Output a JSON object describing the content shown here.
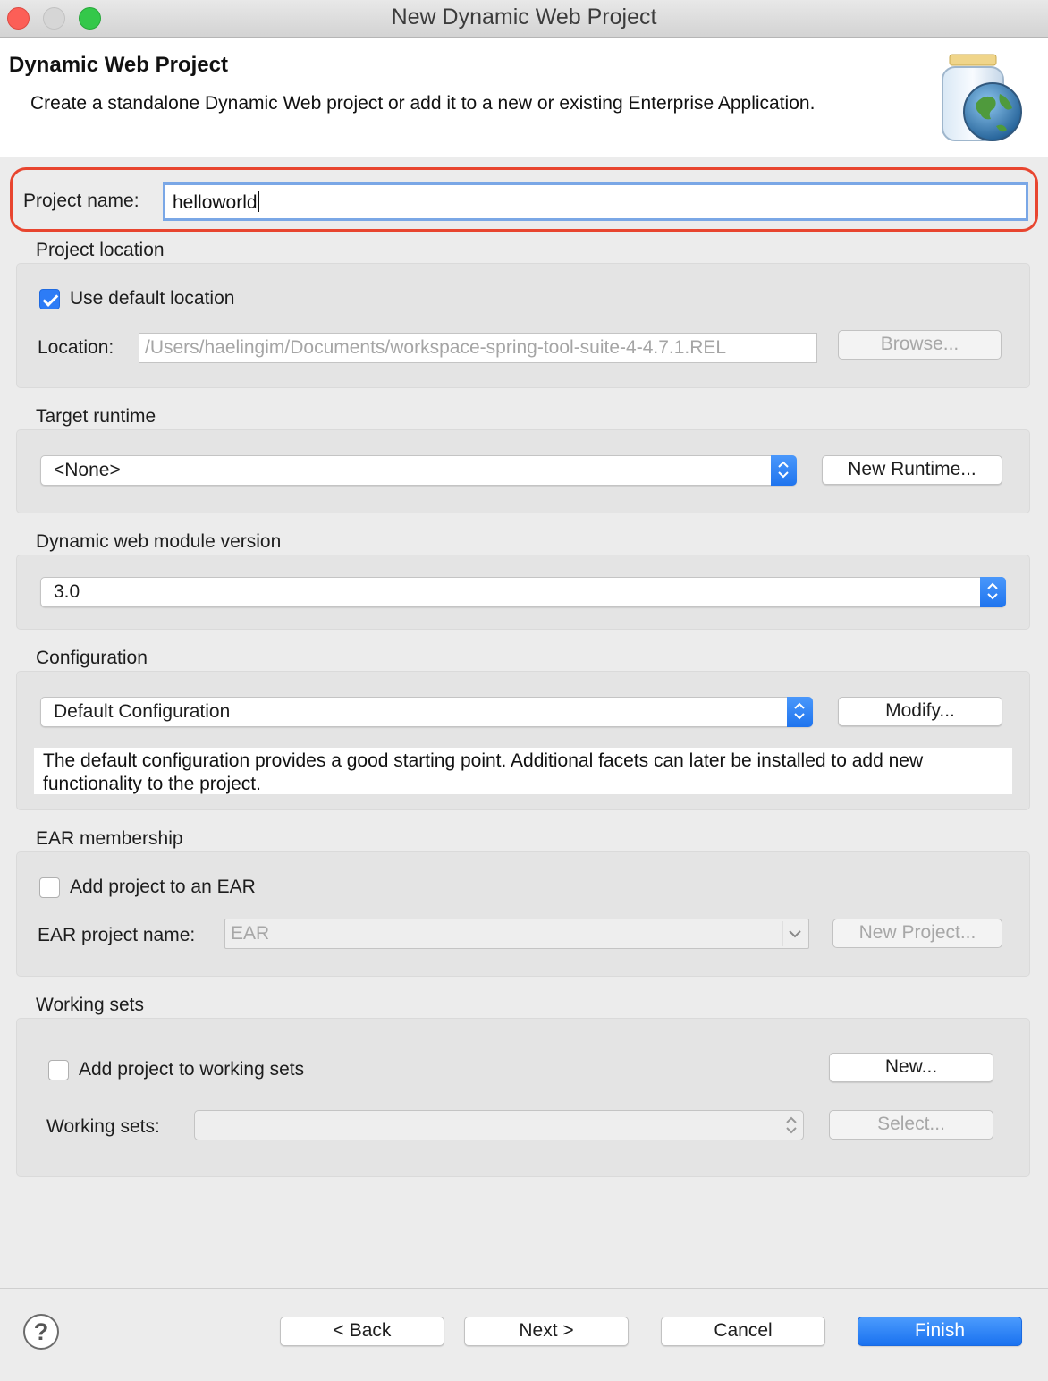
{
  "window": {
    "title": "New Dynamic Web Project"
  },
  "header": {
    "title": "Dynamic Web Project",
    "description": "Create a standalone Dynamic Web project or add it to a new or existing Enterprise Application."
  },
  "project_name": {
    "label": "Project name:",
    "value": "helloworld"
  },
  "project_location": {
    "group_label": "Project location",
    "use_default_label": "Use default location",
    "use_default_checked": true,
    "location_label": "Location:",
    "location_value": "/Users/haelingim/Documents/workspace-spring-tool-suite-4-4.7.1.REL",
    "browse_label": "Browse..."
  },
  "target_runtime": {
    "group_label": "Target runtime",
    "selected": "<None>",
    "new_runtime_label": "New Runtime..."
  },
  "module_version": {
    "group_label": "Dynamic web module version",
    "selected": "3.0"
  },
  "configuration": {
    "group_label": "Configuration",
    "selected": "Default Configuration",
    "modify_label": "Modify...",
    "description": "The default configuration provides a good starting point. Additional facets can later be installed to add new functionality to the project."
  },
  "ear_membership": {
    "group_label": "EAR membership",
    "add_label": "Add project to an EAR",
    "add_checked": false,
    "name_label": "EAR project name:",
    "name_value": "EAR",
    "new_project_label": "New Project..."
  },
  "working_sets": {
    "group_label": "Working sets",
    "add_label": "Add project to working sets",
    "add_checked": false,
    "new_label": "New...",
    "sets_label": "Working sets:",
    "select_label": "Select..."
  },
  "footer": {
    "help_symbol": "?",
    "back_label": "< Back",
    "next_label": "Next >",
    "cancel_label": "Cancel",
    "finish_label": "Finish"
  },
  "colors": {
    "accent": "#2d7cf6",
    "highlight": "#e8452f",
    "finish": "#1a72f0"
  },
  "icons": [
    "web-project-jar-globe-icon",
    "checkmark-icon",
    "stepper-arrows-icon",
    "chevron-down-icon",
    "help-icon"
  ]
}
